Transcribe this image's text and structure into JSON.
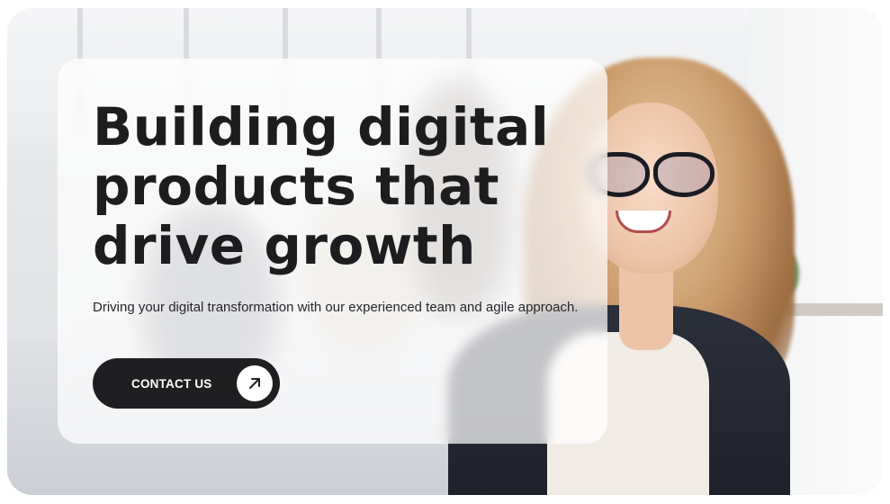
{
  "hero": {
    "headline_lines": [
      "Building digital",
      "products that",
      "drive growth"
    ],
    "subtitle": "Driving your digital transformation with our experienced team and agile approach.",
    "cta_label": "CONTACT US",
    "cta_icon": "arrow-up-right-icon"
  },
  "colors": {
    "text": "#1d1d1f",
    "button_bg": "#1f1f22",
    "button_text": "#ffffff",
    "card_bg": "rgba(255,255,255,0.72)"
  }
}
